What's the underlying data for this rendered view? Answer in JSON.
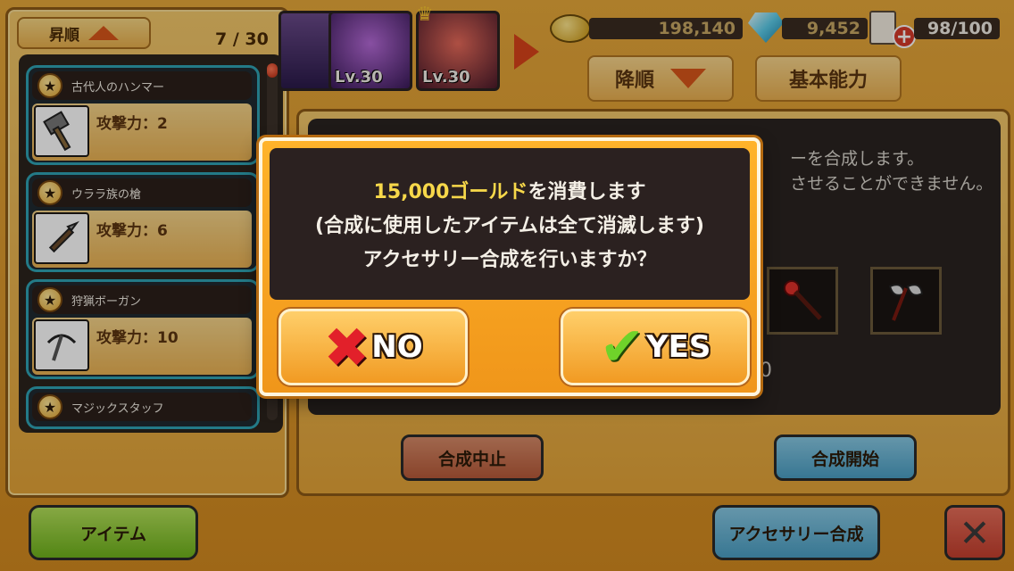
{
  "left_panel": {
    "sort_label": "昇順",
    "counter": "7 / 30",
    "items": [
      {
        "name": "古代人のハンマー",
        "atk": "攻撃力：2",
        "icon": "hammer-icon"
      },
      {
        "name": "ウララ族の槍",
        "atk": "攻撃力：6",
        "icon": "spear-icon"
      },
      {
        "name": "狩猟ボーガン",
        "atk": "攻撃力：10",
        "icon": "crossbow-icon"
      },
      {
        "name": "マジックスタッフ",
        "atk": "",
        "icon": "staff-icon"
      }
    ]
  },
  "top_bar": {
    "portraits": [
      {
        "level": "Lv.30"
      },
      {
        "level": "Lv.30"
      }
    ],
    "gold": "198,140",
    "gems": "9,452",
    "cards": "98/100",
    "sort_desc_label": "降順",
    "filter_label": "基本能力"
  },
  "right_panel": {
    "info_line1": "ーを合成します。",
    "info_line2": "させることができません。",
    "info_digit": "0",
    "cancel_label": "合成中止",
    "start_label": "合成開始"
  },
  "bottom_bar": {
    "item_label": "アイテム",
    "accessory_label": "アクセサリー合成",
    "close_label": "✕"
  },
  "dialog": {
    "gold_amount": "15,000ゴールド",
    "line1_suffix": "を消費します",
    "line2": "(合成に使用したアイテムは全て消滅します)",
    "line3": "アクセサリー合成を行いますか？",
    "no_label": "NO",
    "yes_label": "YES"
  },
  "colors": {
    "panel_orange": "#e4a438",
    "dialog_orange": "#f0961a",
    "gold_text": "#f7d84a",
    "teal_border": "#2fa3b4"
  }
}
